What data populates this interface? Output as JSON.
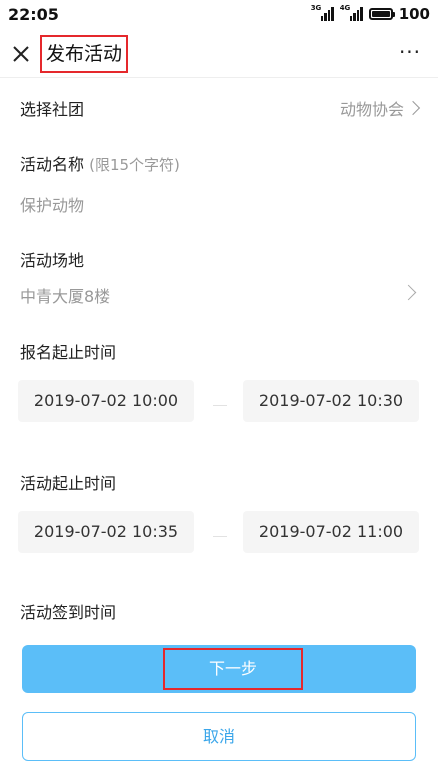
{
  "status_bar": {
    "time": "22:05",
    "signal1_tag": "3G",
    "signal2_tag": "4G",
    "battery": "100"
  },
  "nav": {
    "title": "发布活动",
    "more": "···"
  },
  "form": {
    "club_label": "选择社团",
    "club_value": "动物协会",
    "name_label": "活动名称",
    "name_hint": "(限15个字符)",
    "name_value": "保护动物",
    "venue_label": "活动场地",
    "venue_value": "中青大厦8楼",
    "signup_label": "报名起止时间",
    "signup_start": "2019-07-02 10:00",
    "signup_end": "2019-07-02 10:30",
    "activity_label": "活动起止时间",
    "activity_start": "2019-07-02 10:35",
    "activity_end": "2019-07-02 11:00",
    "checkin_label": "活动签到时间"
  },
  "buttons": {
    "next": "下一步",
    "cancel": "取消"
  },
  "colors": {
    "accent": "#5bbef8",
    "highlight_border": "#e5282c",
    "muted_text": "#999999"
  }
}
